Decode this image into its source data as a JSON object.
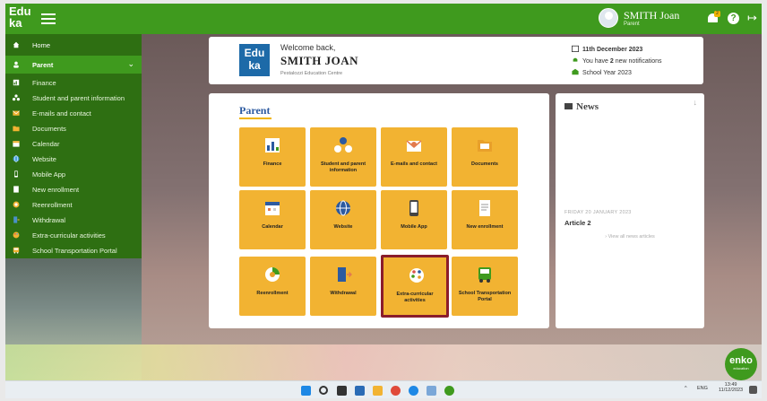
{
  "topbar": {
    "logo_line1": "Edu",
    "logo_line2": "ka",
    "user_name": "SMITH Joan",
    "user_role": "Parent",
    "notification_badge": "2"
  },
  "sidebar": {
    "items": [
      {
        "label": "Home",
        "icon": "home-icon"
      },
      {
        "label": "Parent",
        "icon": "user-icon"
      },
      {
        "label": "Finance",
        "icon": "finance-icon"
      },
      {
        "label": "Student and parent information",
        "icon": "people-icon"
      },
      {
        "label": "E-mails and contact",
        "icon": "mail-icon"
      },
      {
        "label": "Documents",
        "icon": "folder-icon"
      },
      {
        "label": "Calendar",
        "icon": "calendar-icon"
      },
      {
        "label": "Website",
        "icon": "globe-icon"
      },
      {
        "label": "Mobile App",
        "icon": "phone-icon"
      },
      {
        "label": "New enrollment",
        "icon": "document-icon"
      },
      {
        "label": "Reenrollment",
        "icon": "refresh-icon"
      },
      {
        "label": "Withdrawal",
        "icon": "door-icon"
      },
      {
        "label": "Extra-curricular activities",
        "icon": "palette-icon"
      },
      {
        "label": "School Transportation Portal",
        "icon": "bus-icon"
      }
    ]
  },
  "welcome": {
    "logo_line1": "Edu",
    "logo_line2": "ka",
    "greeting": "Welcome back,",
    "name": "SMITH JOAN",
    "school": "Pestalozzi Education Centre",
    "date": "11th December 2023",
    "notifications_prefix": "You have ",
    "notifications_count": "2",
    "notifications_suffix": " new notifications",
    "school_year": "School Year 2023"
  },
  "parent_panel": {
    "title": "Parent",
    "tiles": [
      {
        "label": "Finance",
        "icon": "finance-icon"
      },
      {
        "label": "Student and parent information",
        "icon": "people-icon"
      },
      {
        "label": "E-mails and contact",
        "icon": "mail-icon"
      },
      {
        "label": "Documents",
        "icon": "folder-icon"
      },
      {
        "label": "Calendar",
        "icon": "calendar-icon"
      },
      {
        "label": "Website",
        "icon": "globe-icon"
      },
      {
        "label": "Mobile App",
        "icon": "phone-icon"
      },
      {
        "label": "New enrollment",
        "icon": "document-icon"
      },
      {
        "label": "Reenrollment",
        "icon": "refresh-icon"
      },
      {
        "label": "Withdrawal",
        "icon": "door-icon"
      },
      {
        "label": "Extra-curricular activities",
        "icon": "palette-icon"
      },
      {
        "label": "School Transportation Portal",
        "icon": "bus-icon"
      }
    ]
  },
  "news": {
    "title": "News",
    "date": "FRIDAY 20 JANUARY 2023",
    "article": "Article 2",
    "view_all": "› View all news articles"
  },
  "enko": {
    "line1": "enko",
    "line2": "education"
  },
  "taskbar": {
    "lang": "ENG",
    "time": "13:49",
    "date": "11/12/2023"
  },
  "colors": {
    "brand_green": "#3f9a1e",
    "sidebar_green": "#2e6f12",
    "tile_yellow": "#f2b332",
    "selected_border": "#8a1d2b",
    "title_blue": "#2c5aa0"
  }
}
